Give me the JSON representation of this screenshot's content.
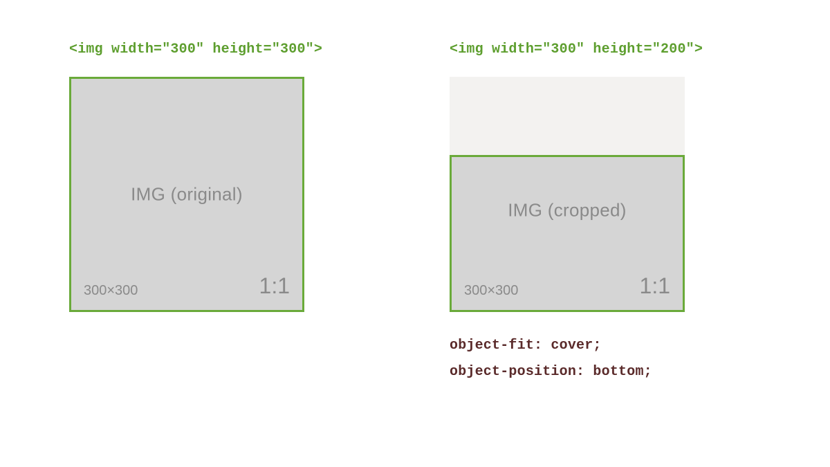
{
  "left": {
    "header": "<img width=\"300\" height=\"300\">",
    "center_label": "IMG (original)",
    "dims": "300×300",
    "ratio": "1:1"
  },
  "right": {
    "header": "<img width=\"300\" height=\"200\">",
    "center_label": "IMG (cropped)",
    "dims": "300×300",
    "ratio": "1:1",
    "css_line_1": "object-fit: cover;",
    "css_line_2": "object-position: bottom;"
  }
}
